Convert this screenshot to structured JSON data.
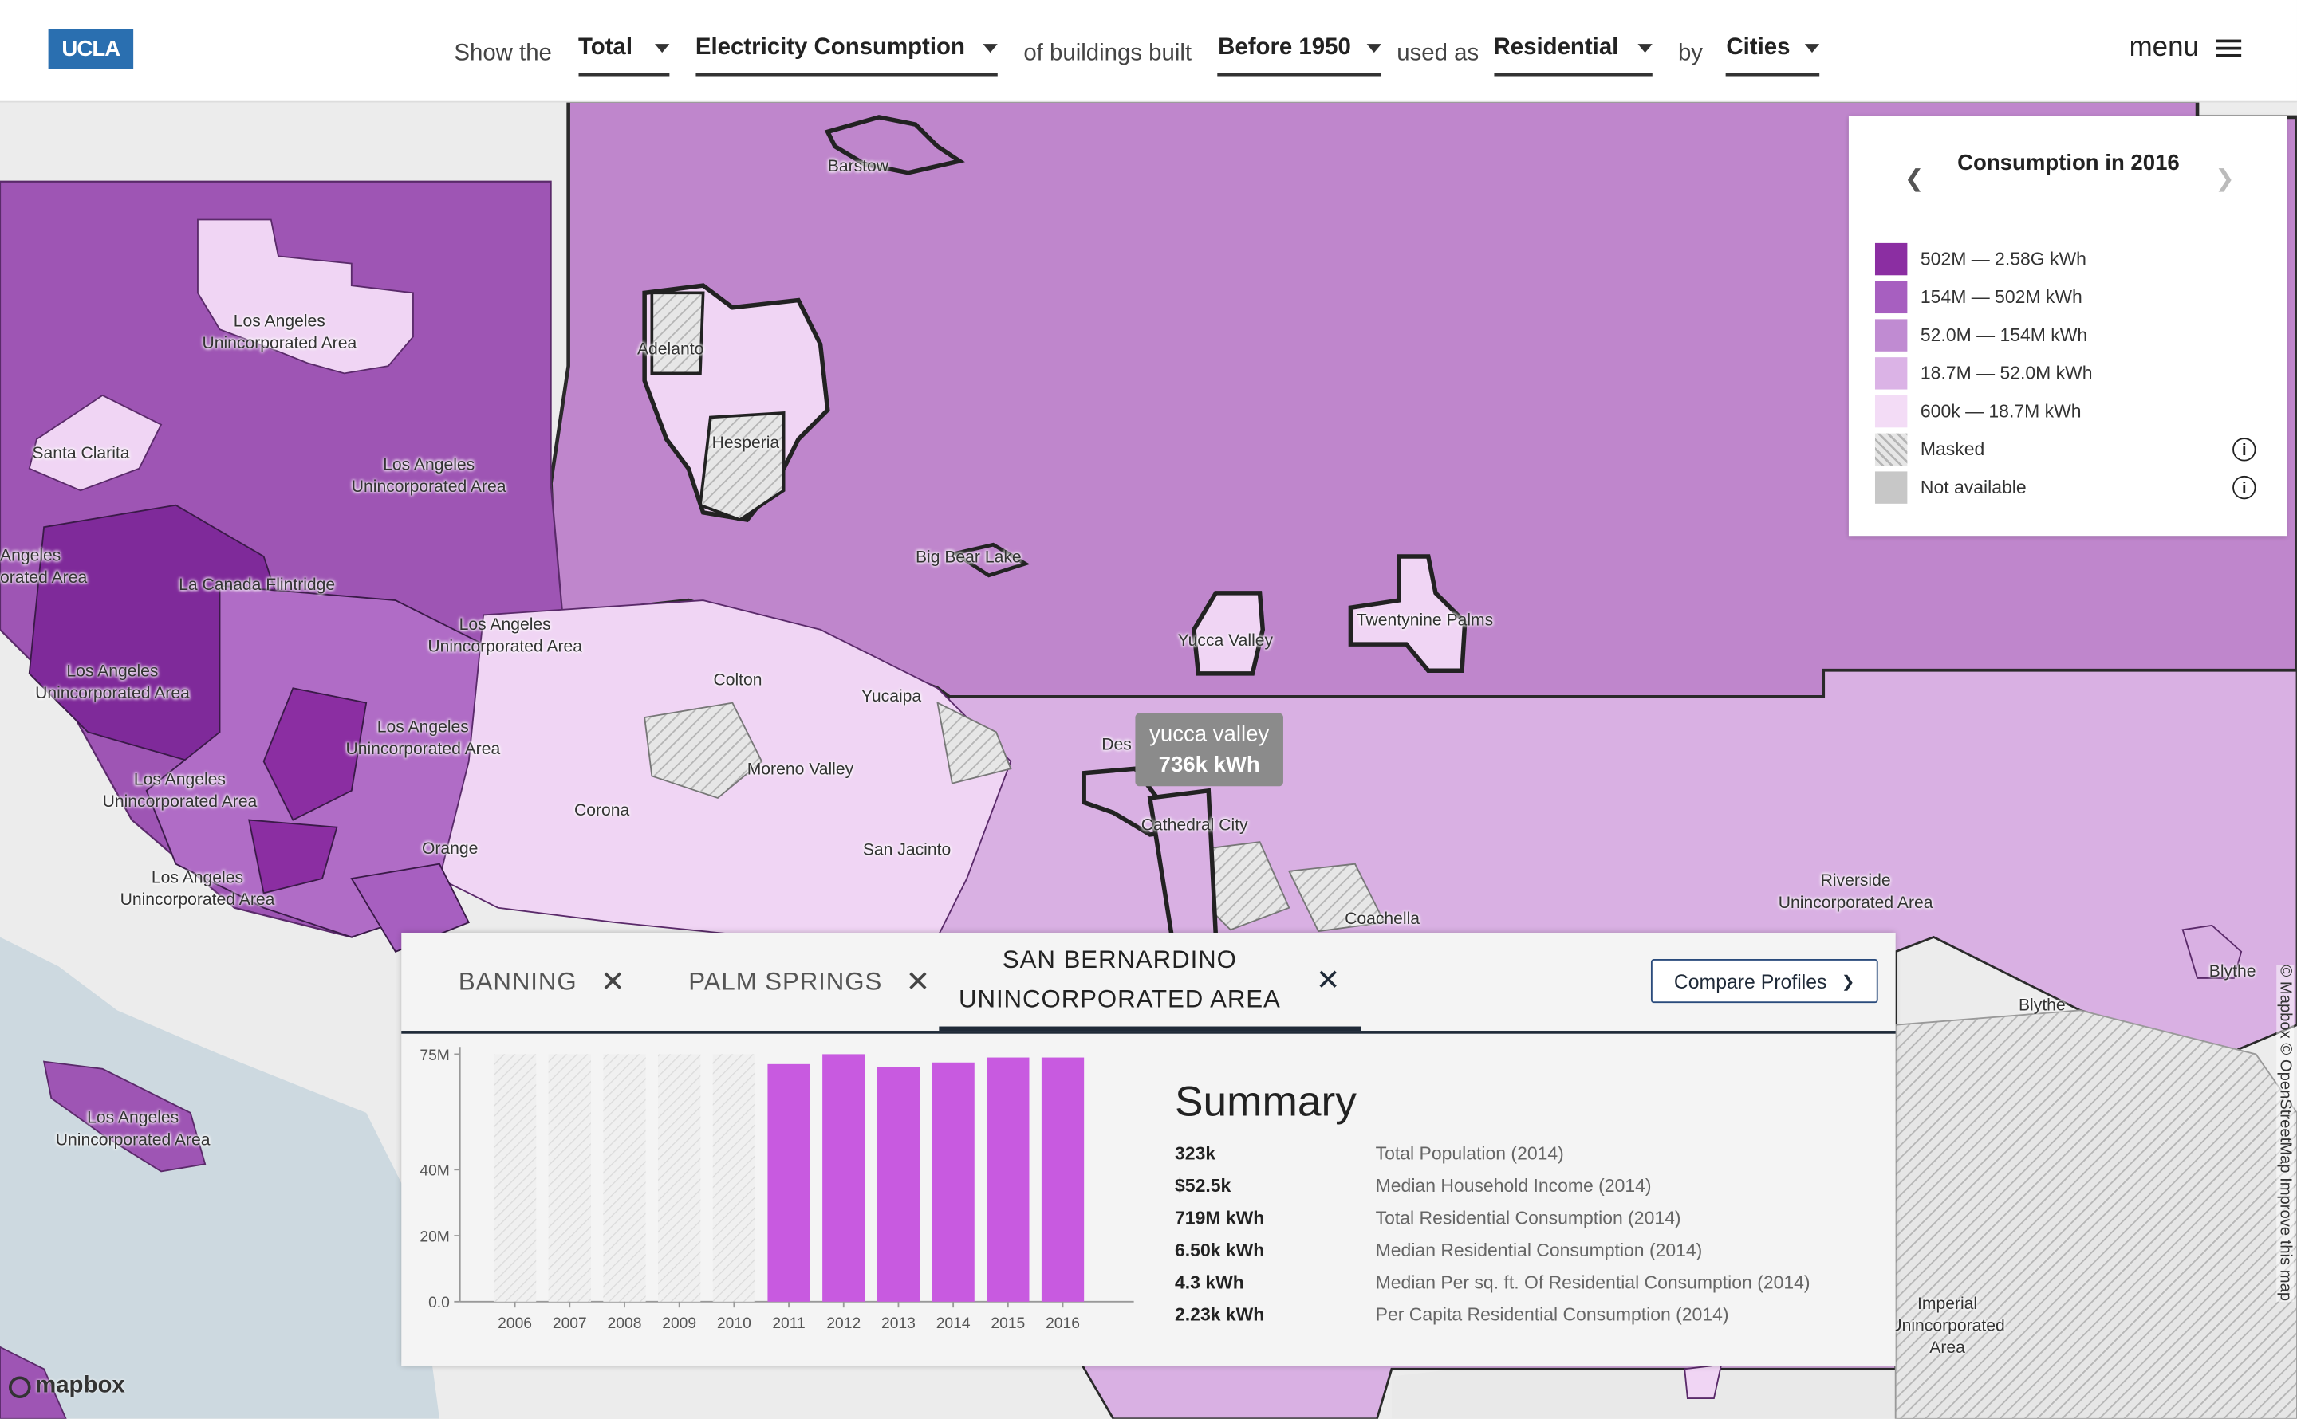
{
  "logo": "UCLA",
  "filters": {
    "show_the": "Show the",
    "aggregation": "Total",
    "metric": "Electricity Consumption",
    "of_buildings_built": "of buildings built",
    "year_built": "Before 1950",
    "used_as": "used as",
    "usage": "Residential",
    "by": "by",
    "geography": "Cities"
  },
  "menu_label": "menu",
  "legend": {
    "title": "Consumption in 2016",
    "items": [
      {
        "label": "502M — 2.58G kWh",
        "color": "#8b2ea2"
      },
      {
        "label": "154M — 502M kWh",
        "color": "#a75fc0"
      },
      {
        "label": "52.0M — 154M kWh",
        "color": "#c08bd2"
      },
      {
        "label": "18.7M — 52.0M kWh",
        "color": "#dbb3e6"
      },
      {
        "label": "600k — 18.7M kWh",
        "color": "#f3dcf6"
      },
      {
        "label": "Masked",
        "color": "#e3e3e3"
      },
      {
        "label": "Not available",
        "color": "#c7c7c7"
      }
    ]
  },
  "places": [
    "Barstow",
    "Los Angeles\nUnincorporated Area",
    "Adelanto",
    "Hesperia",
    "Santa Clarita",
    "Los Angeles\nUnincorporated Area",
    "Big Bear Lake",
    "Yucca Valley",
    "Twentynine Palms",
    "La Canada Flintridge",
    "Los Angeles\nUnincorporated Area",
    "Los Angeles\nUnincorporated Area",
    "Colton",
    "Yucaipa",
    "Los Angeles\nUnincorporated Area",
    "Angeles\norated Area",
    "Moreno Valley",
    "Corona",
    "Los Angeles\nUnincorporated Area",
    "Orange",
    "San Jacinto",
    "Cathedral City",
    "Los Angeles\nUnincorporated Area",
    "Coachella",
    "Riverside\nUnincorporated Area",
    "Blythe",
    "Blythe",
    "Los Angeles\nUnincorporated Area",
    "Imperial\nUnincorporated\nArea",
    "Des"
  ],
  "tooltip": {
    "name": "yucca valley",
    "value": "736k kWh"
  },
  "tabs": [
    {
      "label": "BANNING"
    },
    {
      "label": "PALM SPRINGS"
    },
    {
      "label": "SAN BERNARDINO\nUNINCORPORATED AREA"
    }
  ],
  "compare_label": "Compare Profiles",
  "summary": {
    "title": "Summary",
    "stats": [
      {
        "value": "323k",
        "label": "Total Population (2014)"
      },
      {
        "value": "$52.5k",
        "label": "Median Household Income (2014)"
      },
      {
        "value": "719M kWh",
        "label": "Total Residential Consumption (2014)"
      },
      {
        "value": "6.50k kWh",
        "label": "Median Residential Consumption (2014)"
      },
      {
        "value": "4.3 kWh",
        "label": "Median Per sq. ft. Of Residential Consumption (2014)"
      },
      {
        "value": "2.23k kWh",
        "label": "Per Capita Residential Consumption (2014)"
      }
    ]
  },
  "chart_data": {
    "type": "bar",
    "categories": [
      "2006",
      "2007",
      "2008",
      "2009",
      "2010",
      "2011",
      "2012",
      "2013",
      "2014",
      "2015",
      "2016"
    ],
    "values": [
      null,
      null,
      null,
      null,
      null,
      72,
      75,
      71,
      72.5,
      74,
      74
    ],
    "ytick_labels": [
      "0.0",
      "20M",
      "40M",
      "75M"
    ],
    "ytick_values": [
      0,
      20,
      40,
      75
    ],
    "ylim": [
      0,
      75
    ],
    "bar_color": "#c85ae0",
    "missing_style": "hatched"
  },
  "attribution": {
    "mapbox": "mapbox",
    "credits": "© Mapbox © OpenStreetMap Improve this map"
  }
}
